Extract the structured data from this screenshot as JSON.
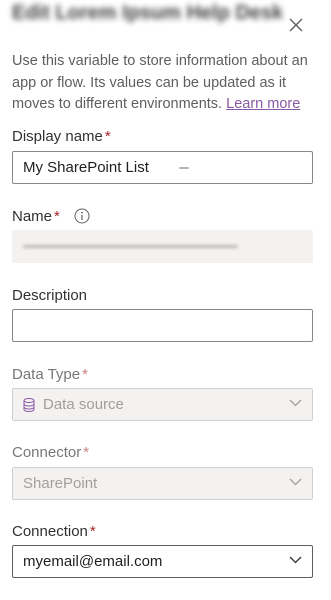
{
  "panel": {
    "title": "Edit Lorem Ipsum Help Desk",
    "description": "Use this variable to store information about an app or flow. Its values can be updated as it moves to different environments.",
    "learn_more": "Learn more"
  },
  "fields": {
    "display_name": {
      "label": "Display name",
      "required_mark": "*",
      "value": "My SharePoint List"
    },
    "name": {
      "label": "Name",
      "required_mark": "*",
      "info_icon": "info-circle-icon"
    },
    "description": {
      "label": "Description",
      "value": ""
    },
    "data_type": {
      "label": "Data Type",
      "required_mark": "*",
      "value": "Data source",
      "icon": "database-icon"
    },
    "connector": {
      "label": "Connector",
      "required_mark": "*",
      "value": "SharePoint"
    },
    "connection": {
      "label": "Connection",
      "required_mark": "*",
      "value": "myemail@email.com"
    }
  },
  "colors": {
    "required": "#a4262c",
    "link": "#8a58a4",
    "disabled_bg": "#f3f2f1"
  }
}
